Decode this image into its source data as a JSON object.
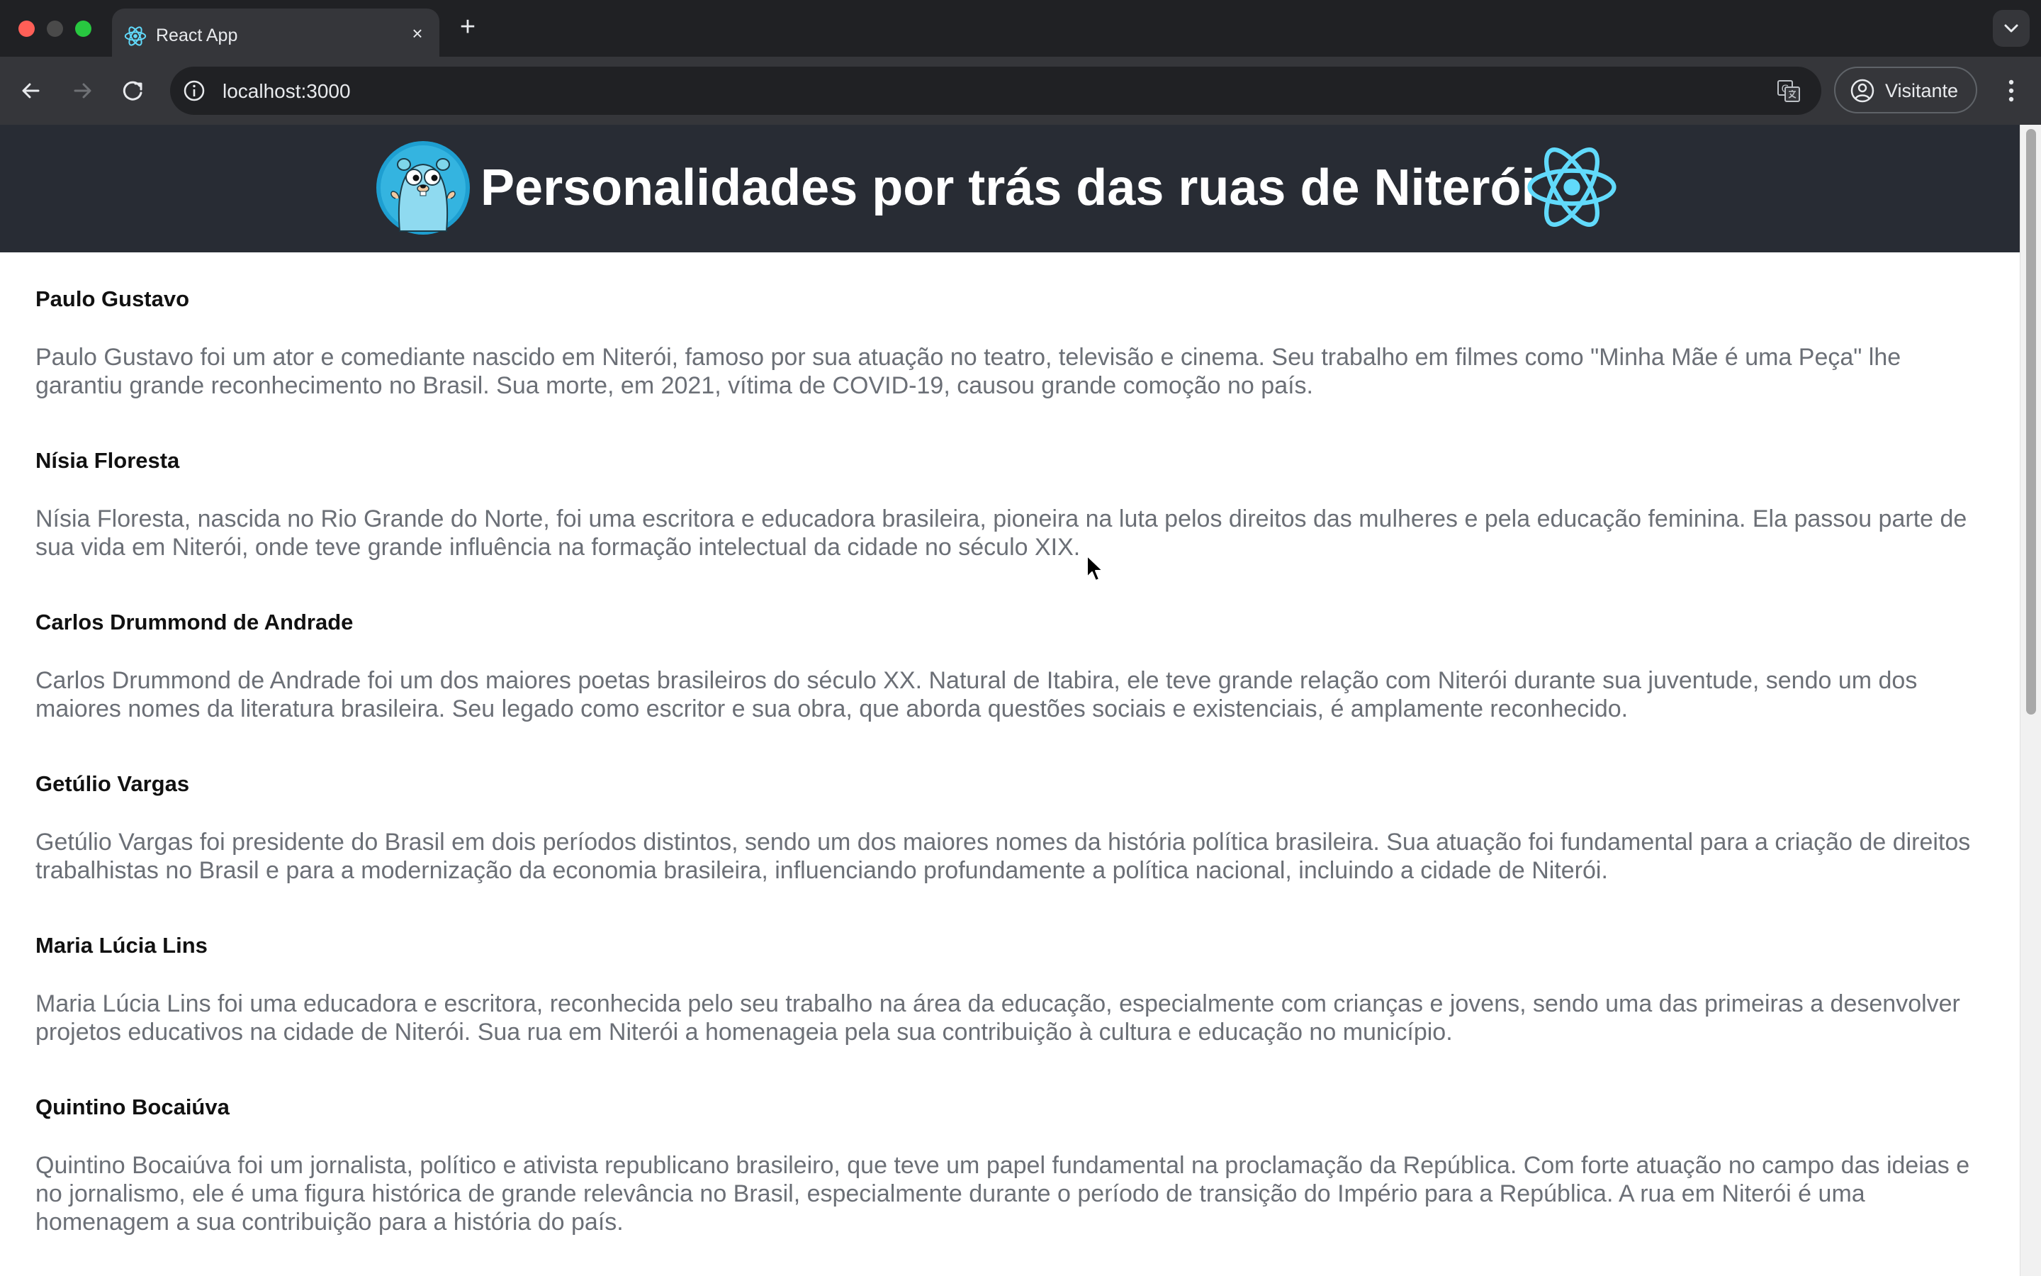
{
  "browser": {
    "tab_title": "React App",
    "tab_close": "×",
    "new_tab": "+",
    "url": "localhost:3000",
    "profile_label": "Visitante",
    "icons": {
      "back": "arrow-left-icon",
      "forward": "arrow-right-icon",
      "reload": "reload-icon",
      "site_info": "info-icon",
      "translate": "translate-icon",
      "profile": "user-circle-icon",
      "menu": "more-vert-icon",
      "tab_list": "chevron-down-icon"
    }
  },
  "header": {
    "title": "Personalidades por trás das ruas de Niterói",
    "background": "#282c34",
    "logos": [
      "go-gopher-logo",
      "react-logo"
    ]
  },
  "people": [
    {
      "name": "Paulo Gustavo",
      "description": "Paulo Gustavo foi um ator e comediante nascido em Niterói, famoso por sua atuação no teatro, televisão e cinema. Seu trabalho em filmes como \"Minha Mãe é uma Peça\" lhe garantiu grande reconhecimento no Brasil. Sua morte, em 2021, vítima de COVID-19, causou grande comoção no país."
    },
    {
      "name": "Nísia Floresta",
      "description": "Nísia Floresta, nascida no Rio Grande do Norte, foi uma escritora e educadora brasileira, pioneira na luta pelos direitos das mulheres e pela educação feminina. Ela passou parte de sua vida em Niterói, onde teve grande influência na formação intelectual da cidade no século XIX."
    },
    {
      "name": "Carlos Drummond de Andrade",
      "description": "Carlos Drummond de Andrade foi um dos maiores poetas brasileiros do século XX. Natural de Itabira, ele teve grande relação com Niterói durante sua juventude, sendo um dos maiores nomes da literatura brasileira. Seu legado como escritor e sua obra, que aborda questões sociais e existenciais, é amplamente reconhecido."
    },
    {
      "name": "Getúlio Vargas",
      "description": "Getúlio Vargas foi presidente do Brasil em dois períodos distintos, sendo um dos maiores nomes da história política brasileira. Sua atuação foi fundamental para a criação de direitos trabalhistas no Brasil e para a modernização da economia brasileira, influenciando profundamente a política nacional, incluindo a cidade de Niterói."
    },
    {
      "name": "Maria Lúcia Lins",
      "description": "Maria Lúcia Lins foi uma educadora e escritora, reconhecida pelo seu trabalho na área da educação, especialmente com crianças e jovens, sendo uma das primeiras a desenvolver projetos educativos na cidade de Niterói. Sua rua em Niterói a homenageia pela sua contribuição à cultura e educação no município."
    },
    {
      "name": "Quintino Bocaiúva",
      "description": "Quintino Bocaiúva foi um jornalista, político e ativista republicano brasileiro, que teve um papel fundamental na proclamação da República. Com forte atuação no campo das ideias e no jornalismo, ele é uma figura histórica de grande relevância no Brasil, especialmente durante o período de transição do Império para a República. A rua em Niterói é uma homenagem a sua contribuição para a história do país."
    }
  ]
}
